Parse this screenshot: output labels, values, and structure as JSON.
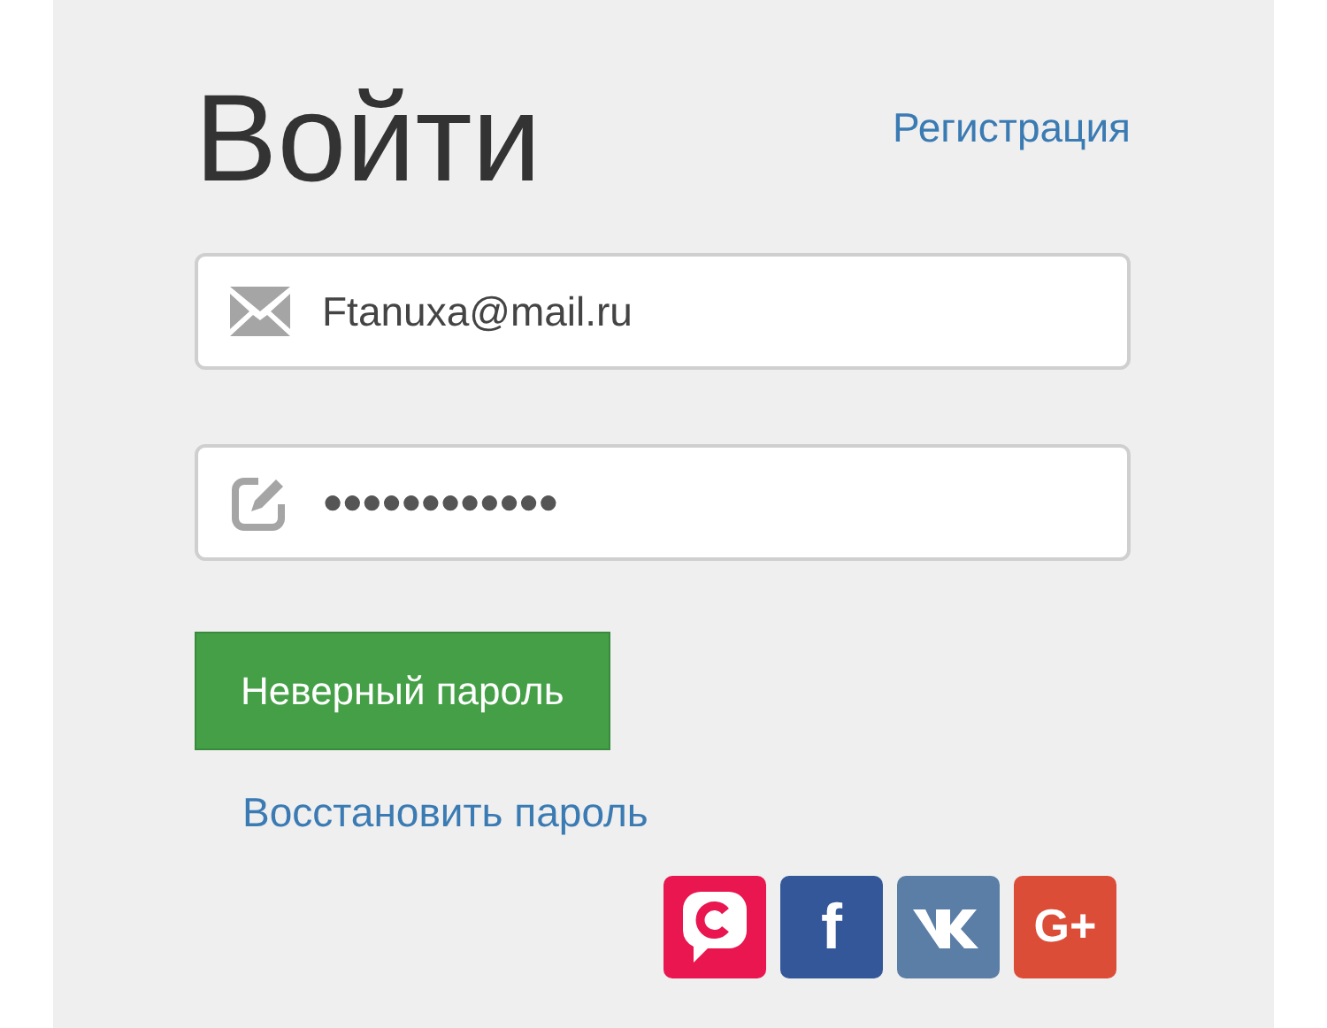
{
  "title": "Войти",
  "register_link": "Регистрация",
  "fields": [
    {
      "kind": "email",
      "value": "Ftanuxa@mail.ru"
    },
    {
      "kind": "password",
      "value": "●●●●●●●●●●●●"
    }
  ],
  "submit_button": {
    "label": "Неверный пароль",
    "kind": "error"
  },
  "restore_link": "Восстановить пароль",
  "social_buttons": [
    {
      "kind": "chat",
      "color": "#e9164f"
    },
    {
      "kind": "facebook",
      "label": "f",
      "color": "#34579a"
    },
    {
      "kind": "vk",
      "color": "#5a7ea6"
    },
    {
      "kind": "google",
      "label": "G+",
      "color": "#dc4d38"
    }
  ]
}
